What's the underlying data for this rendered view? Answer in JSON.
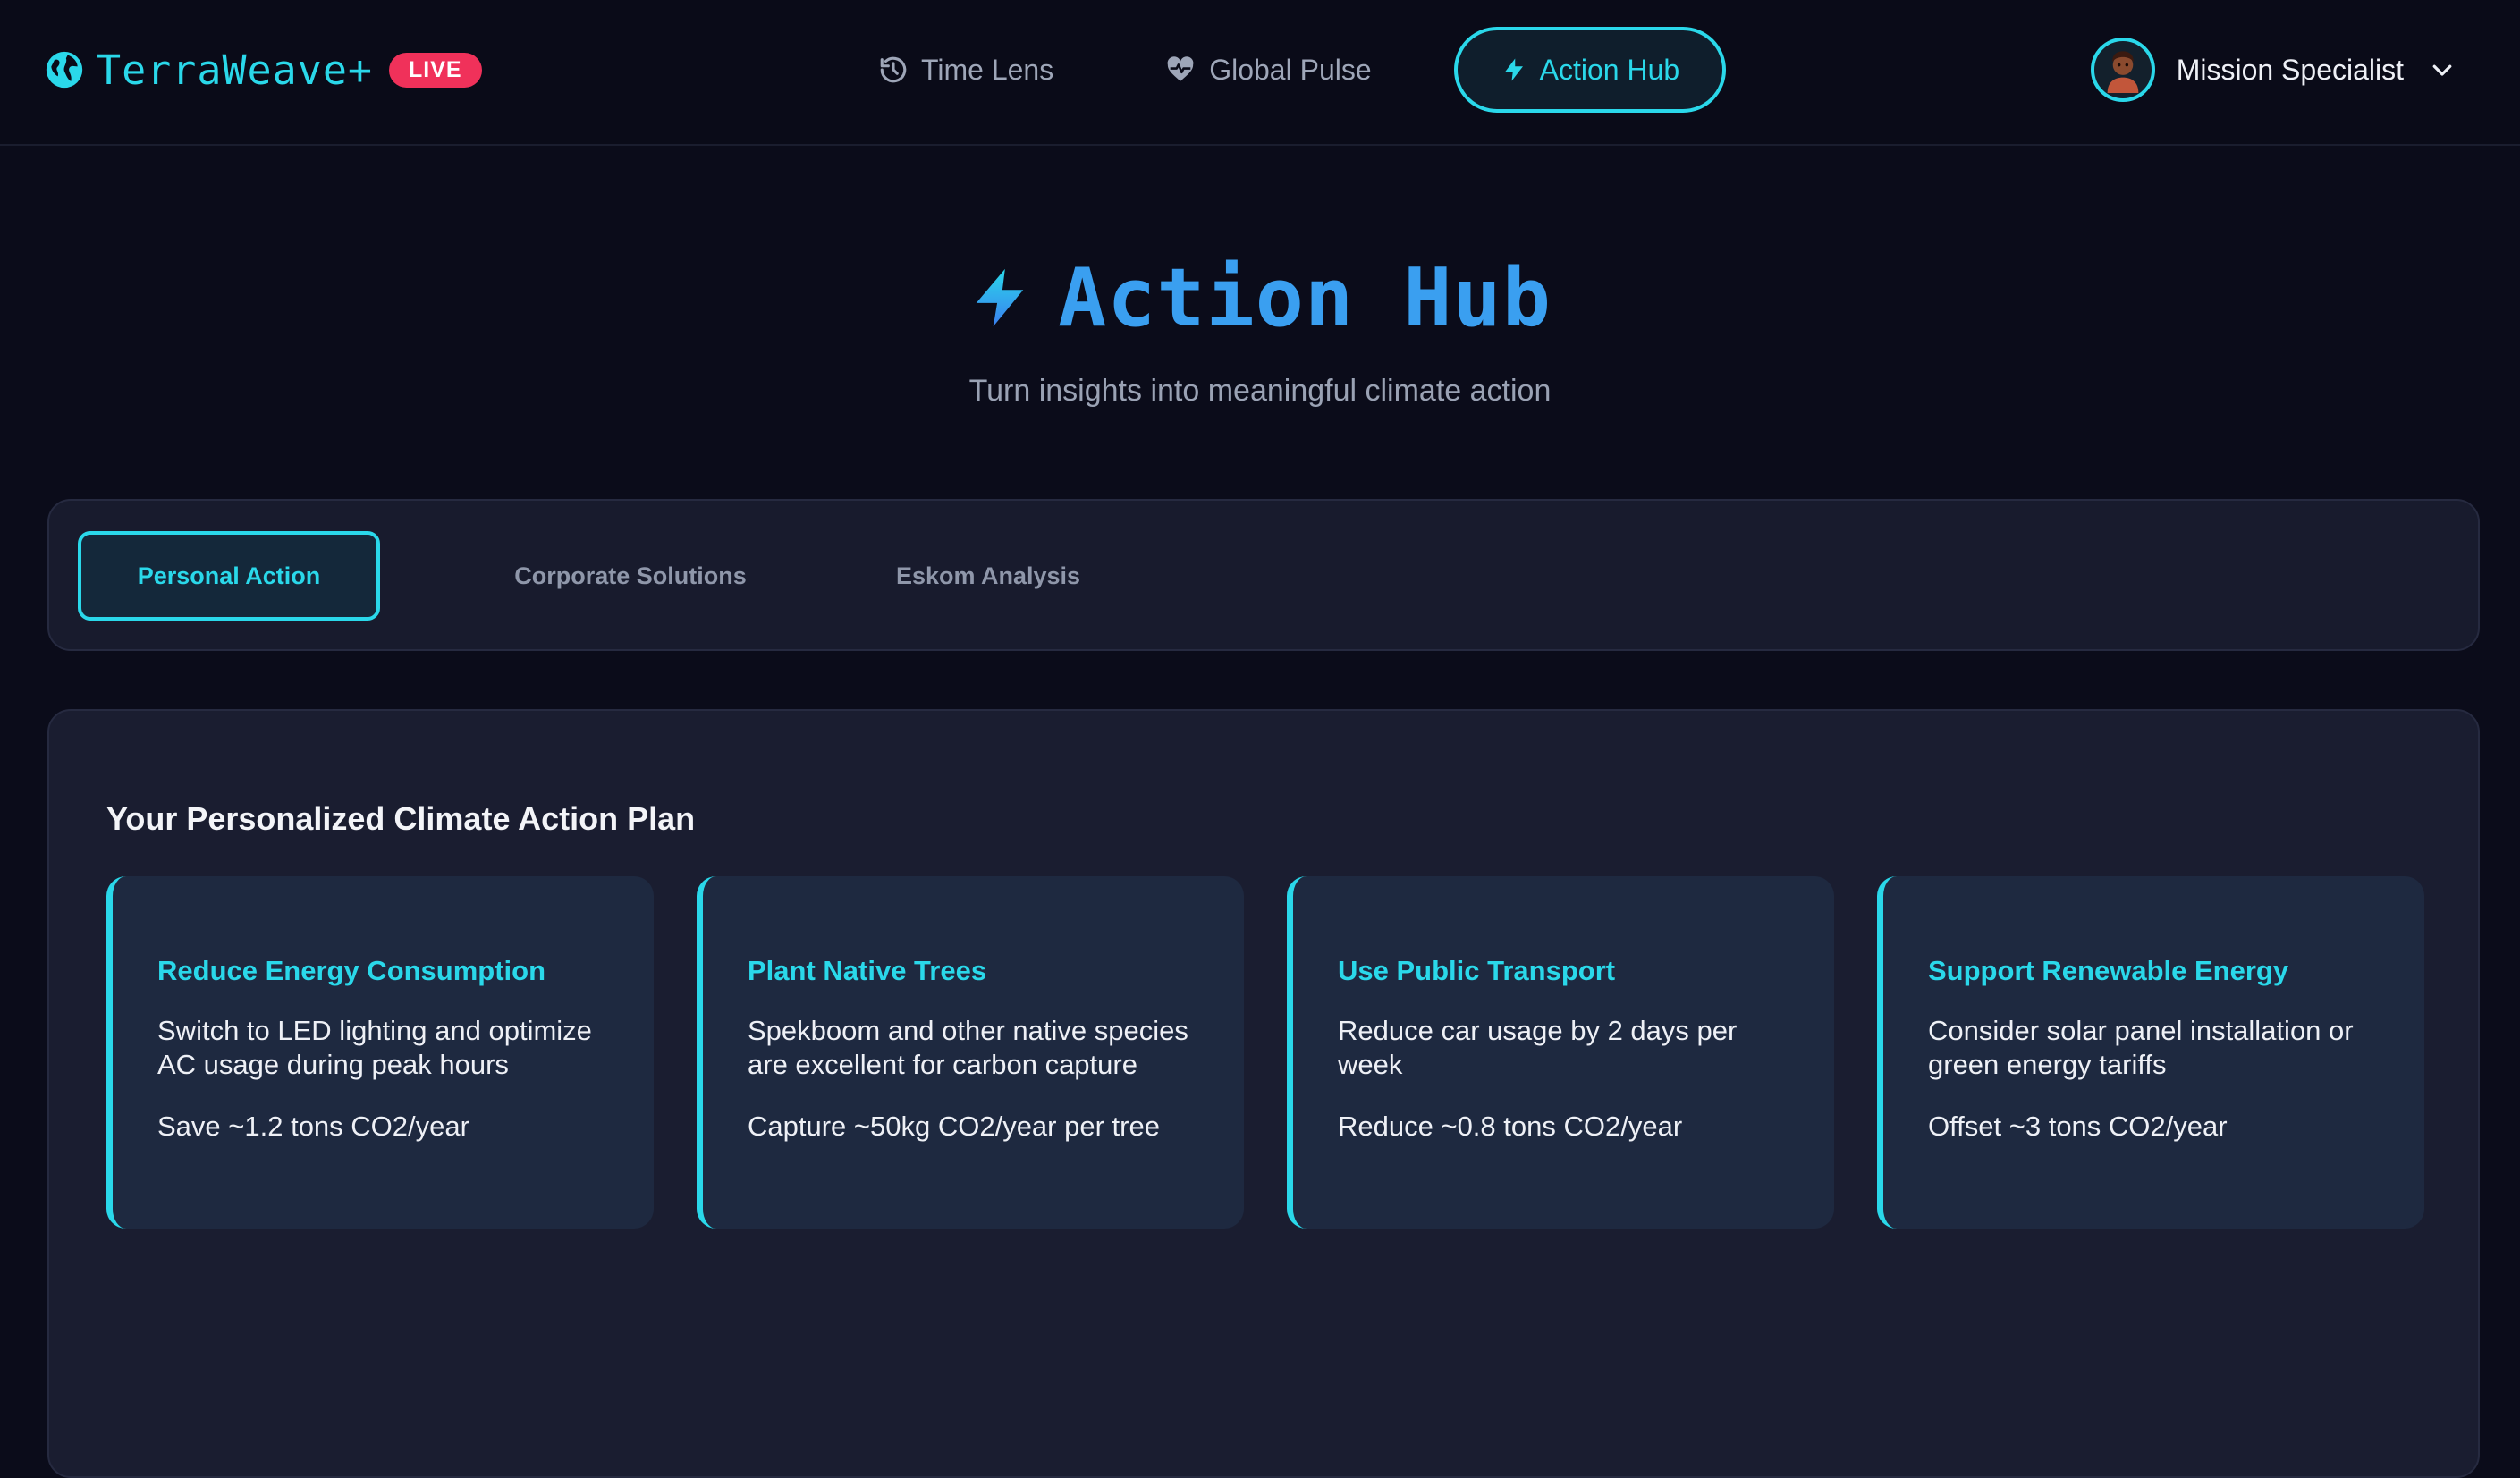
{
  "brand": {
    "name": "TerraWeave+",
    "badge": "LIVE"
  },
  "nav": {
    "items": [
      {
        "label": "Time Lens",
        "icon": "history-icon"
      },
      {
        "label": "Global Pulse",
        "icon": "heart-pulse-icon"
      },
      {
        "label": "Action Hub",
        "icon": "lightning-icon",
        "active": true
      }
    ]
  },
  "user": {
    "name": "Mission Specialist",
    "avatar_icon": "avatar-icon"
  },
  "hero": {
    "title": "Action Hub",
    "subtitle": "Turn insights into meaningful climate action"
  },
  "tabs": [
    {
      "label": "Personal Action",
      "active": true
    },
    {
      "label": "Corporate Solutions"
    },
    {
      "label": "Eskom Analysis"
    }
  ],
  "plan": {
    "title": "Your Personalized Climate Action Plan",
    "cards": [
      {
        "title": "Reduce Energy Consumption",
        "description": "Switch to LED lighting and optimize AC usage during peak hours",
        "impact": "Save ~1.2 tons CO2/year"
      },
      {
        "title": "Plant Native Trees",
        "description": "Spekboom and other native species are excellent for carbon capture",
        "impact": "Capture ~50kg CO2/year per tree"
      },
      {
        "title": "Use Public Transport",
        "description": "Reduce car usage by 2 days per week",
        "impact": "Reduce ~0.8 tons CO2/year"
      },
      {
        "title": "Support Renewable Energy",
        "description": "Consider solar panel installation or green energy tariffs",
        "impact": "Offset ~3 tons CO2/year"
      }
    ]
  },
  "colors": {
    "accent": "#2ad8ea",
    "hero_blue": "#3a9ff0",
    "live_badge": "#f0315a",
    "background": "#0b0c1a"
  }
}
